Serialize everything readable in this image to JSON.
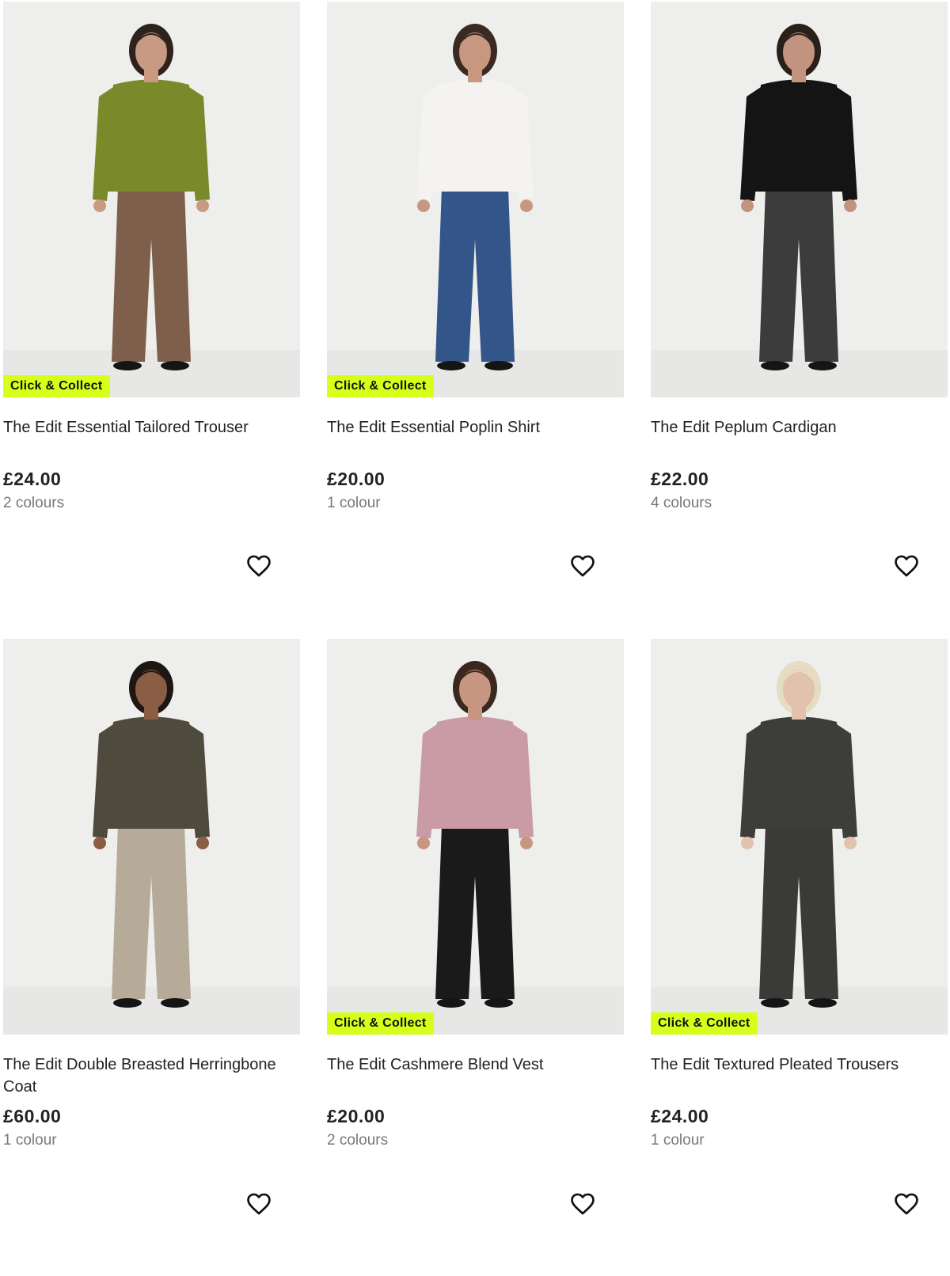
{
  "products": [
    {
      "name": "The Edit Essential Tailored Trouser",
      "price": "£24.00",
      "colours": "2 colours",
      "badge": "Click & Collect",
      "top_color": "#7a8a2a",
      "bottom_color": "#7d5f4c",
      "skin": "#c89a82",
      "hair": "#2e221c"
    },
    {
      "name": "The Edit Essential Poplin Shirt",
      "price": "£20.00",
      "colours": "1 colour",
      "badge": "Click & Collect",
      "top_color": "#f4f3ef",
      "bottom_color": "#34558a",
      "skin": "#c7987f",
      "hair": "#3a2a22"
    },
    {
      "name": "The Edit Peplum Cardigan",
      "price": "£22.00",
      "colours": "4 colours",
      "badge": "",
      "top_color": "#141414",
      "bottom_color": "#3c3c3c",
      "skin": "#c29480",
      "hair": "#2a1f1a"
    },
    {
      "name": "The Edit Double Breasted Herringbone Coat",
      "price": "£60.00",
      "colours": "1 colour",
      "badge": "",
      "top_color": "#4f4a3e",
      "bottom_color": "#b6ab98",
      "skin": "#8a5e45",
      "hair": "#1e1612"
    },
    {
      "name": "The Edit Cashmere Blend Vest",
      "price": "£20.00",
      "colours": "2 colours",
      "badge": "Click & Collect",
      "top_color": "#c99ba5",
      "bottom_color": "#1a1a1a",
      "skin": "#c69680",
      "hair": "#3a281e"
    },
    {
      "name": "The Edit Textured Pleated Trousers",
      "price": "£24.00",
      "colours": "1 colour",
      "badge": "Click & Collect",
      "top_color": "#3d3d3a",
      "bottom_color": "#3a3a38",
      "skin": "#e2c2ad",
      "hair": "#e6dcc4"
    }
  ],
  "icons": {
    "wishlist": "heart-outline-icon"
  },
  "colors": {
    "badge_bg": "#d6ff1a",
    "image_bg": "#eeeeed",
    "text": "#222222",
    "muted": "#777777"
  }
}
